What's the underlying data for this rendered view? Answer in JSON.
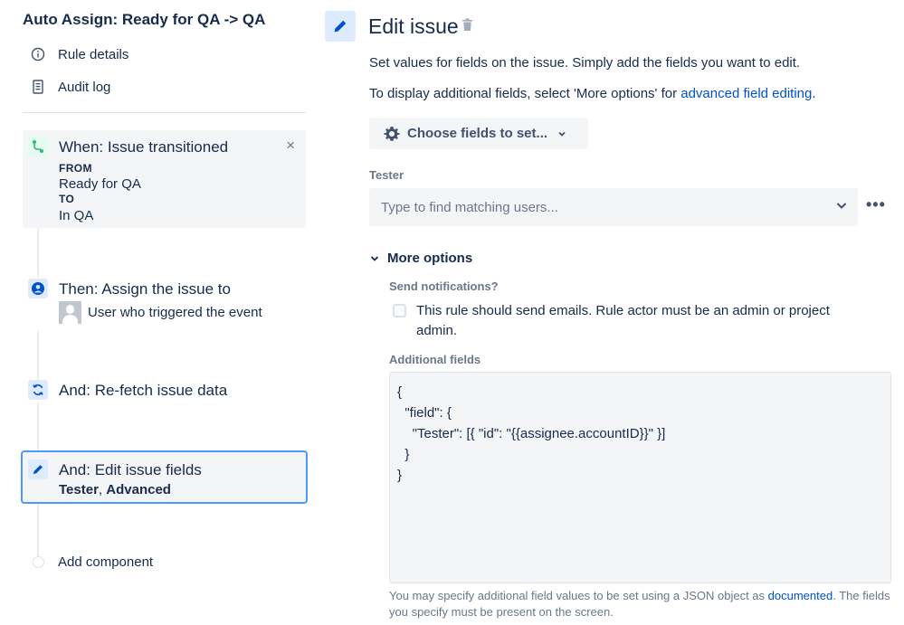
{
  "rule": {
    "title": "Auto Assign: Ready for QA -> QA",
    "links": [
      {
        "label": "Rule details",
        "icon": "info-icon"
      },
      {
        "label": "Audit log",
        "icon": "document-icon"
      }
    ]
  },
  "components": {
    "trigger": {
      "title": "When: Issue transitioned",
      "from_label": "FROM",
      "from_value": "Ready for QA",
      "to_label": "TO",
      "to_value": "In QA",
      "close": "×"
    },
    "assign": {
      "title": "Then: Assign the issue to",
      "user": "User who triggered the event"
    },
    "refetch": {
      "title": "And: Re-fetch issue data"
    },
    "edit": {
      "title": "And: Edit issue fields",
      "sub_field1": "Tester",
      "sub_sep": ", ",
      "sub_field2": "Advanced"
    },
    "add": {
      "label": "Add component"
    }
  },
  "panel": {
    "title": "Edit issue",
    "desc1": "Set values for fields on the issue. Simply add the fields you want to edit.",
    "desc2_prefix": "To display additional fields, select 'More options' for ",
    "desc2_link": "advanced field editing",
    "desc2_suffix": ".",
    "choose_label": "Choose fields to set...",
    "tester_label": "Tester",
    "tester_placeholder": "Type to find matching users...",
    "more_dots": "•••",
    "more_options": "More options",
    "send_label": "Send notifications?",
    "checkbox_text": "This rule should send emails. Rule actor must be an admin or project admin.",
    "additional_label": "Additional fields",
    "additional_value": "{\n  \"field\": {\n    \"Tester\": [{ \"id\": \"{{assignee.accountID}}\" }]\n  }\n}",
    "help_prefix": "You may specify additional field values to be set using a JSON object as ",
    "help_link": "documented",
    "help_suffix": ". The fields you specify must be present on the screen."
  },
  "colors": {
    "accent": "#0052cc",
    "selected_border": "#4c9aff",
    "trigger_icon_bg": "#e3fcef",
    "action_icon_bg": "#deebff"
  }
}
